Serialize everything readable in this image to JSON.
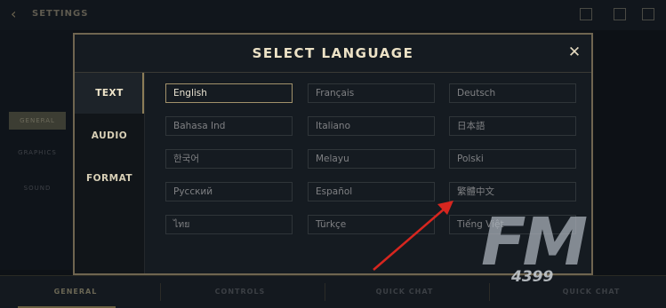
{
  "background": {
    "title": "SETTINGS",
    "side_items": [
      "GENERAL",
      "GRAPHICS",
      "SOUND"
    ],
    "bottom_tabs": [
      "GENERAL",
      "CONTROLS",
      "QUICK CHAT",
      "QUICK CHAT"
    ]
  },
  "modal": {
    "title": "SELECT LANGUAGE",
    "close": "✕",
    "tabs": [
      {
        "label": "TEXT",
        "active": true
      },
      {
        "label": "AUDIO",
        "active": false
      },
      {
        "label": "FORMAT",
        "active": false
      }
    ],
    "languages": [
      {
        "label": "English",
        "selected": true
      },
      {
        "label": "Français"
      },
      {
        "label": "Deutsch"
      },
      {
        "label": "Bahasa Ind"
      },
      {
        "label": "Italiano"
      },
      {
        "label": "日本語"
      },
      {
        "label": "한국어"
      },
      {
        "label": "Melayu"
      },
      {
        "label": "Polski"
      },
      {
        "label": "Русский"
      },
      {
        "label": "Español"
      },
      {
        "label": "繁體中文"
      },
      {
        "label": "ไทย"
      },
      {
        "label": "Türkçe"
      },
      {
        "label": "Tiếng Việt"
      }
    ]
  },
  "annotation": {
    "arrow_color": "#d7261f"
  },
  "watermark": {
    "text": "FM",
    "number": "4399"
  }
}
